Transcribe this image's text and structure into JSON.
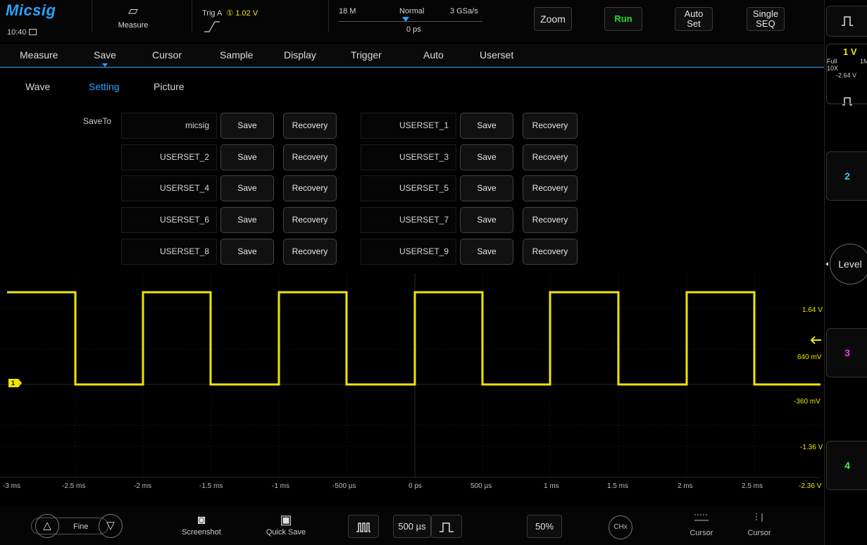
{
  "topbar": {
    "logo": "Micsig",
    "time": "10:40",
    "measure_label": "Measure",
    "trigger_label": "Trig A",
    "trigger_level": "① 1.02 V",
    "memory_depth": "18 M",
    "acq_mode": "Normal",
    "sample_rate": "3 GSa/s",
    "trigger_delay": "0 ps",
    "zoom_label": "Zoom",
    "run_label": "Run",
    "autoset_line1": "Auto",
    "autoset_line2": "Set",
    "single_line1": "Single",
    "single_line2": "SEQ"
  },
  "menu": {
    "items": [
      "Measure",
      "Save",
      "Cursor",
      "Sample",
      "Display",
      "Trigger",
      "Auto",
      "Userset"
    ],
    "selected": "Save"
  },
  "submenu": {
    "items": [
      "Wave",
      "Setting",
      "Picture"
    ],
    "active": "Setting"
  },
  "save_panel": {
    "save_to_label": "SaveTo",
    "save_label": "Save",
    "recovery_label": "Recovery",
    "slots": [
      "micsig",
      "USERSET_1",
      "USERSET_2",
      "USERSET_3",
      "USERSET_4",
      "USERSET_5",
      "USERSET_6",
      "USERSET_7",
      "USERSET_8",
      "USERSET_9"
    ]
  },
  "waveform": {
    "channel_marker": "1",
    "channel_color": "#f0e500",
    "shape": "square",
    "high_level_v": 1.64,
    "low_level_v": -0.36,
    "trigger_level_v": 1.02,
    "volt_labels": [
      "1.64 V",
      "640 mV",
      "-360 mV",
      "-1.36 V",
      "-2.36 V"
    ],
    "time_labels": [
      "-3 ms",
      "-2.5 ms",
      "-2 ms",
      "-1.5 ms",
      "-1 ms",
      "-500 µs",
      "0 ps",
      "500 µs",
      "1 ms",
      "1.5 ms",
      "2 ms",
      "2.5 ms"
    ]
  },
  "bottombar": {
    "fine_label": "Fine",
    "screenshot_label": "Screenshot",
    "quicksave_label": "Quick Save",
    "timebase_value": "500 µs",
    "percent_value": "50%",
    "chx_label": "CHx",
    "cursor_h_label": "Cursor",
    "cursor_v_label": "Cursor"
  },
  "rightpanel": {
    "ch1_volts": "1 V",
    "ch1_bw": "Full",
    "ch1_imp": "1M",
    "ch1_probe": "10X",
    "ch1_offset": "-2.64 V",
    "ch2_label": "2",
    "ch3_label": "3",
    "ch4_label": "4",
    "level_label": "Level",
    "ch2_color": "#33ccff",
    "ch3_color": "#ff33ff",
    "ch4_color": "#33ff33"
  }
}
